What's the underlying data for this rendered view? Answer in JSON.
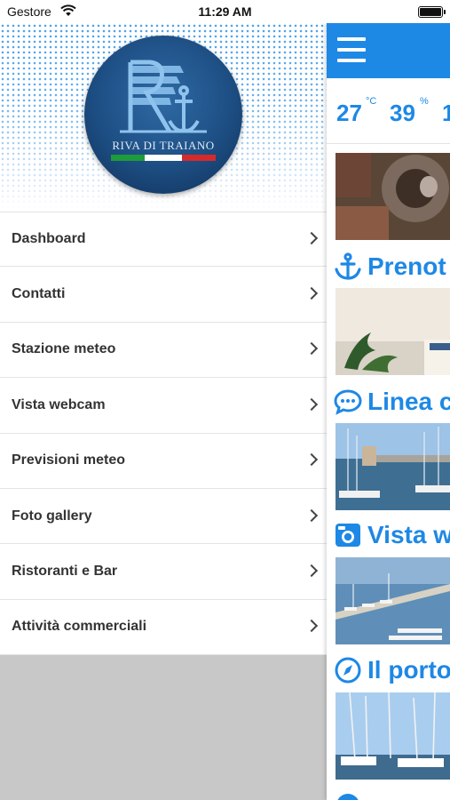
{
  "status_bar": {
    "carrier": "Gestore",
    "time": "11:29 AM"
  },
  "drawer": {
    "logo_text": "RIVA DI TRAIANO",
    "menu": [
      {
        "label": "Dashboard"
      },
      {
        "label": "Contatti"
      },
      {
        "label": "Stazione meteo"
      },
      {
        "label": "Vista webcam"
      },
      {
        "label": "Previsioni meteo"
      },
      {
        "label": "Foto gallery"
      },
      {
        "label": "Ristoranti e Bar"
      },
      {
        "label": "Attività commerciali"
      }
    ]
  },
  "main": {
    "weather": {
      "temperature": "27",
      "temperature_unit": "°C",
      "humidity": "39",
      "humidity_unit": "%",
      "third_value": "1"
    },
    "sections": [
      {
        "icon": "anchor-icon",
        "title": "Prenot"
      },
      {
        "icon": "chat-bubble-icon",
        "title": "Linea c"
      },
      {
        "icon": "camera-icon",
        "title": "Vista w"
      },
      {
        "icon": "compass-icon",
        "title": "Il porto"
      }
    ],
    "accent_color": "#1e88e5"
  }
}
